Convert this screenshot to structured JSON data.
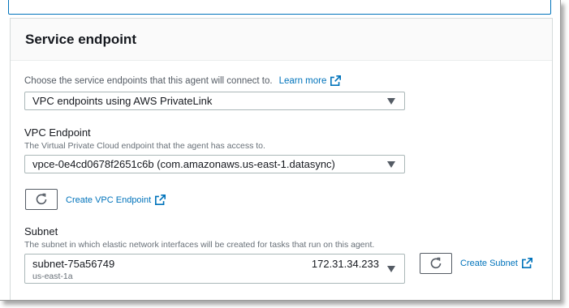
{
  "section": {
    "title": "Service endpoint",
    "intro": "Choose the service endpoints that this agent will connect to.",
    "learn_more": "Learn more"
  },
  "endpoint_type": {
    "selected": "VPC endpoints using AWS PrivateLink"
  },
  "vpc_endpoint": {
    "label": "VPC Endpoint",
    "description": "The Virtual Private Cloud endpoint that the agent has access to.",
    "selected": "vpce-0e4cd0678f2651c6b (com.amazonaws.us-east-1.datasync)",
    "create_link": "Create VPC Endpoint"
  },
  "subnet": {
    "label": "Subnet",
    "description": "The subnet in which elastic network interfaces will be created for tasks that run on this agent.",
    "selected_id": "subnet-75a56749",
    "selected_az": "us-east-1a",
    "selected_cidr": "172.31.34.233",
    "create_link": "Create Subnet"
  },
  "icons": [
    "external-link-icon",
    "refresh-icon",
    "caret-down-icon"
  ],
  "colors": {
    "link": "#0073bb",
    "border": "#aab7b8",
    "focus": "#0073bb"
  }
}
